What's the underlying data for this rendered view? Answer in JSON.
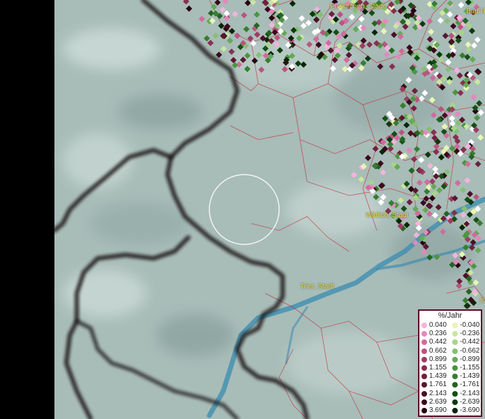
{
  "places": [
    {
      "name": "Euskirchen, Stadt",
      "key": "euskirchen"
    },
    {
      "name": "Bad H",
      "key": "badh"
    },
    {
      "name": "Wittlich, Stadt",
      "key": "wittlich"
    },
    {
      "name": "Trier, Stadt",
      "key": "trier"
    },
    {
      "name": "Id",
      "key": "id"
    }
  ],
  "legend": {
    "title": "%/Jahr",
    "positive": [
      {
        "label": "0.040",
        "color": "#f2b4dc"
      },
      {
        "label": "0.236",
        "color": "#e488bc"
      },
      {
        "label": "0.442",
        "color": "#cf6c9d"
      },
      {
        "label": "0.662",
        "color": "#b8567f"
      },
      {
        "label": "0.899",
        "color": "#9c3d63"
      },
      {
        "label": "1.155",
        "color": "#86304f"
      },
      {
        "label": "1.439",
        "color": "#6e213b"
      },
      {
        "label": "1.761",
        "color": "#5a1730"
      },
      {
        "label": "2.143",
        "color": "#4a0f24"
      },
      {
        "label": "2.639",
        "color": "#3a091b"
      },
      {
        "label": "3.690",
        "color": "#250410"
      }
    ],
    "negative": [
      {
        "label": "-0.040",
        "color": "#e9f5b4"
      },
      {
        "label": "-0.236",
        "color": "#c9e7a0"
      },
      {
        "label": "-0.442",
        "color": "#a8d48a"
      },
      {
        "label": "-0.662",
        "color": "#86c072"
      },
      {
        "label": "-0.899",
        "color": "#65a957"
      },
      {
        "label": "-1.155",
        "color": "#4c9541"
      },
      {
        "label": "-1.439",
        "color": "#367e30"
      },
      {
        "label": "-1.761",
        "color": "#246522"
      },
      {
        "label": "-2.143",
        "color": "#164f16"
      },
      {
        "label": "-2.639",
        "color": "#0c3a0c"
      },
      {
        "label": "-3.690",
        "color": "#062606"
      }
    ]
  },
  "colors": {
    "terrain": "#a9bdb9",
    "border": "#141010",
    "admin_lines": "#c0303a",
    "water": "#3f8fb0",
    "highlight": "#ffffff"
  }
}
